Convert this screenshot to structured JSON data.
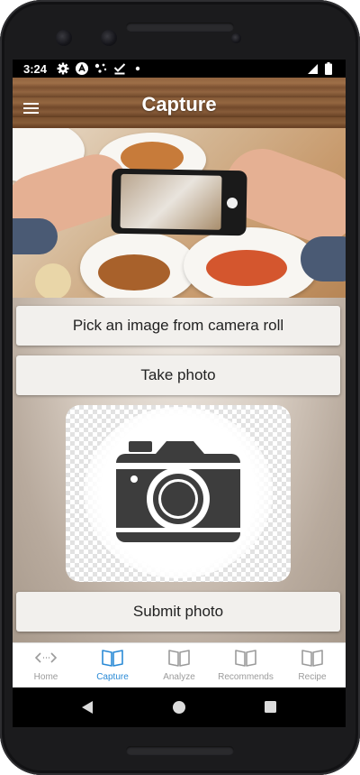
{
  "status_bar": {
    "time": "3:24"
  },
  "app_bar": {
    "title": "Capture",
    "menu_icon": "hamburger-menu-icon"
  },
  "actions": {
    "pick_image_label": "Pick an image from camera roll",
    "take_photo_label": "Take photo",
    "submit_photo_label": "Submit photo"
  },
  "placeholder": {
    "icon": "camera-icon"
  },
  "bottom_nav": {
    "active_color": "#2a8ad6",
    "inactive_color": "#9b9b9b",
    "items": [
      {
        "label": "Home",
        "icon": "code-arrows-icon"
      },
      {
        "label": "Capture",
        "icon": "book-open-icon"
      },
      {
        "label": "Analyze",
        "icon": "book-open-icon"
      },
      {
        "label": "Recommends",
        "icon": "book-open-icon"
      },
      {
        "label": "Recipe",
        "icon": "book-open-icon"
      }
    ],
    "active_index": 1
  }
}
